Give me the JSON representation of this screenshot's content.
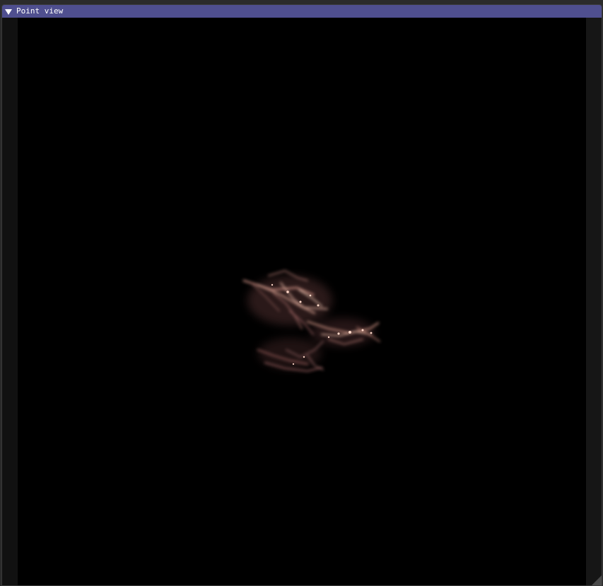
{
  "window": {
    "title": "Point view",
    "collapse_icon": "triangle-down-icon"
  },
  "colors": {
    "title_bar": "#4f4f8f",
    "background": "#000000",
    "point_cloud": "#e0a090"
  }
}
